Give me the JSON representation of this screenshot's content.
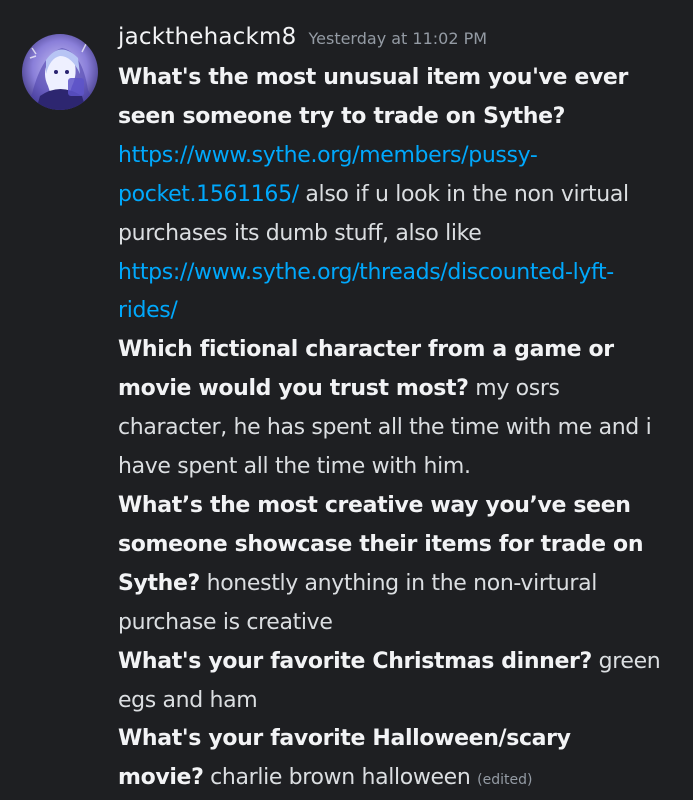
{
  "author": {
    "username": "jackthehackm8",
    "avatar_icon": "anime-avatar-icon"
  },
  "timestamp": "Yesterday at 11:02 PM",
  "colors": {
    "background": "#1e1f22",
    "text": "#dbdee1",
    "bold": "#f2f3f5",
    "link": "#00a8fc",
    "muted": "#949ba4"
  },
  "entries": [
    {
      "question": "What's the most unusual item you've ever seen someone try to trade on Sythe?",
      "link1": "https://www.sythe.org/members/pussy-pocket.1561165/",
      "text1": " also if u look in the non virtual purchases its dumb stuff, also like ",
      "link2": "https://www.sythe.org/threads/discounted-lyft-rides/"
    },
    {
      "question": "Which fictional character from a game or movie would you trust most?",
      "answer": " my osrs character, he has spent all the time with me and i have spent all the time with him."
    },
    {
      "question": "What’s the most creative way you’ve seen someone showcase their items for trade on Sythe?",
      "answer": " honestly anything in the non-virtural purchase is creative"
    },
    {
      "question": "What's your favorite Christmas dinner?",
      "answer": " green egs and ham"
    },
    {
      "question": "What's your favorite Halloween/scary movie?",
      "answer": " charlie brown halloween"
    }
  ],
  "edited_label": "(edited)"
}
